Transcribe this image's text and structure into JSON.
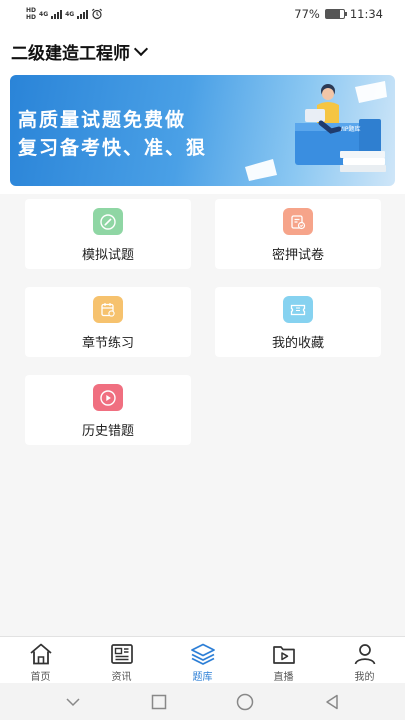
{
  "status_bar": {
    "hd_top": "HD",
    "hd_bottom": "HD",
    "net1": "4G",
    "net2": "4G",
    "battery_text": "77%",
    "battery_level": 0.77,
    "time": "11:34"
  },
  "header": {
    "title": "二级建造工程师"
  },
  "banner": {
    "line1": "高质量试题免费做",
    "line2": "复习备考快、准、狠",
    "book_label": "VIP题库"
  },
  "menu": [
    {
      "label": "模拟试题",
      "icon": "pen-circle-icon",
      "color": "#8fd6a4"
    },
    {
      "label": "密押试卷",
      "icon": "exam-paper-icon",
      "color": "#f6a48a"
    },
    {
      "label": "章节练习",
      "icon": "calendar-note-icon",
      "color": "#f6c26e"
    },
    {
      "label": "我的收藏",
      "icon": "ticket-icon",
      "color": "#86d2f0"
    },
    {
      "label": "历史错题",
      "icon": "play-circle-icon",
      "color": "#f06f80"
    }
  ],
  "tabs": [
    {
      "label": "首页",
      "icon": "home-icon"
    },
    {
      "label": "资讯",
      "icon": "news-icon"
    },
    {
      "label": "题库",
      "icon": "layers-icon"
    },
    {
      "label": "直播",
      "icon": "live-folder-icon"
    },
    {
      "label": "我的",
      "icon": "user-icon"
    }
  ],
  "active_tab": "题库",
  "colors": {
    "accent": "#2d7fd6",
    "banner_blue": "#2a84d8"
  }
}
